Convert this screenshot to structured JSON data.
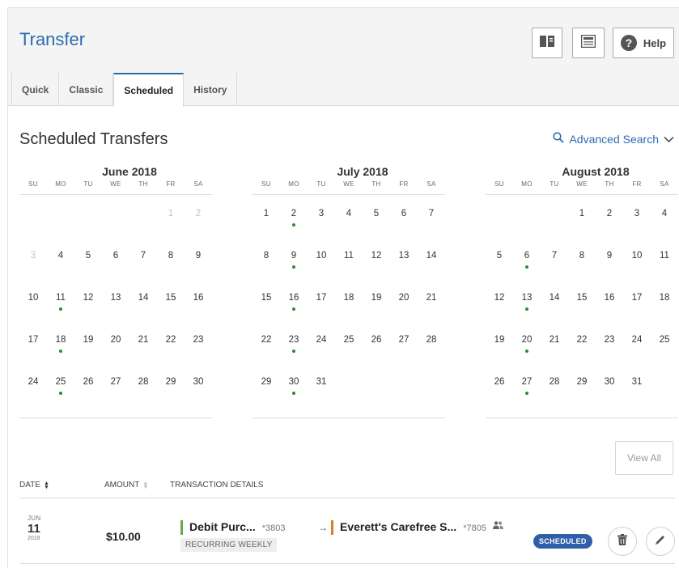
{
  "header": {
    "title": "Transfer",
    "help_label": "Help",
    "tabs": [
      {
        "label": "Quick"
      },
      {
        "label": "Classic"
      },
      {
        "label": "Scheduled"
      },
      {
        "label": "History"
      }
    ]
  },
  "scheduled": {
    "title": "Scheduled Transfers",
    "advanced_search": "Advanced Search",
    "view_all": "View All"
  },
  "weekday_labels": [
    "SU",
    "MO",
    "TU",
    "WE",
    "TH",
    "FR",
    "SA"
  ],
  "calendars": [
    {
      "month": "June 2018",
      "weeks": [
        [
          "",
          "",
          "",
          "",
          "",
          "1",
          "2"
        ],
        [
          "3",
          "4",
          "5",
          "6",
          "7",
          "8",
          "9"
        ],
        [
          "10",
          "11",
          "12",
          "13",
          "14",
          "15",
          "16"
        ],
        [
          "17",
          "18",
          "19",
          "20",
          "21",
          "22",
          "23"
        ],
        [
          "24",
          "25",
          "26",
          "27",
          "28",
          "29",
          "30"
        ]
      ],
      "faded_days": [
        "1",
        "2",
        "3"
      ],
      "scheduled_days": [
        "11",
        "18",
        "25"
      ]
    },
    {
      "month": "July 2018",
      "weeks": [
        [
          "1",
          "2",
          "3",
          "4",
          "5",
          "6",
          "7"
        ],
        [
          "8",
          "9",
          "10",
          "11",
          "12",
          "13",
          "14"
        ],
        [
          "15",
          "16",
          "17",
          "18",
          "19",
          "20",
          "21"
        ],
        [
          "22",
          "23",
          "24",
          "25",
          "26",
          "27",
          "28"
        ],
        [
          "29",
          "30",
          "31",
          "",
          "",
          "",
          ""
        ]
      ],
      "faded_days": [],
      "scheduled_days": [
        "2",
        "9",
        "16",
        "23",
        "30"
      ]
    },
    {
      "month": "August 2018",
      "weeks": [
        [
          "",
          "",
          "",
          "1",
          "2",
          "3",
          "4"
        ],
        [
          "5",
          "6",
          "7",
          "8",
          "9",
          "10",
          "11"
        ],
        [
          "12",
          "13",
          "14",
          "15",
          "16",
          "17",
          "18"
        ],
        [
          "19",
          "20",
          "21",
          "22",
          "23",
          "24",
          "25"
        ],
        [
          "26",
          "27",
          "28",
          "29",
          "30",
          "31",
          ""
        ]
      ],
      "faded_days": [],
      "scheduled_days": [
        "6",
        "13",
        "20",
        "27"
      ]
    }
  ],
  "table": {
    "headers": {
      "date": "DATE",
      "amount": "AMOUNT",
      "details": "TRANSACTION DETAILS"
    },
    "rows": [
      {
        "month": "JUN",
        "day": "11",
        "year": "2018",
        "amount": "$10.00",
        "from_name": "Debit Purc...",
        "from_number": "*3803",
        "to_name": "Everett's Carefree S...",
        "to_number": "*7805",
        "frequency": "RECURRING WEEKLY",
        "status": "SCHEDULED"
      }
    ]
  },
  "colors": {
    "accent": "#2b6cb0",
    "scheduled_dot": "#2e8b2e",
    "from_account_bar": "#6aa84f",
    "to_account_bar": "#e07b24",
    "status_badge": "#2f5fa8"
  },
  "icons": [
    "book-icon",
    "statement-icon",
    "help-icon",
    "search-icon",
    "chevron-down-icon",
    "sort-icon",
    "people-icon",
    "trash-icon",
    "pencil-icon"
  ]
}
